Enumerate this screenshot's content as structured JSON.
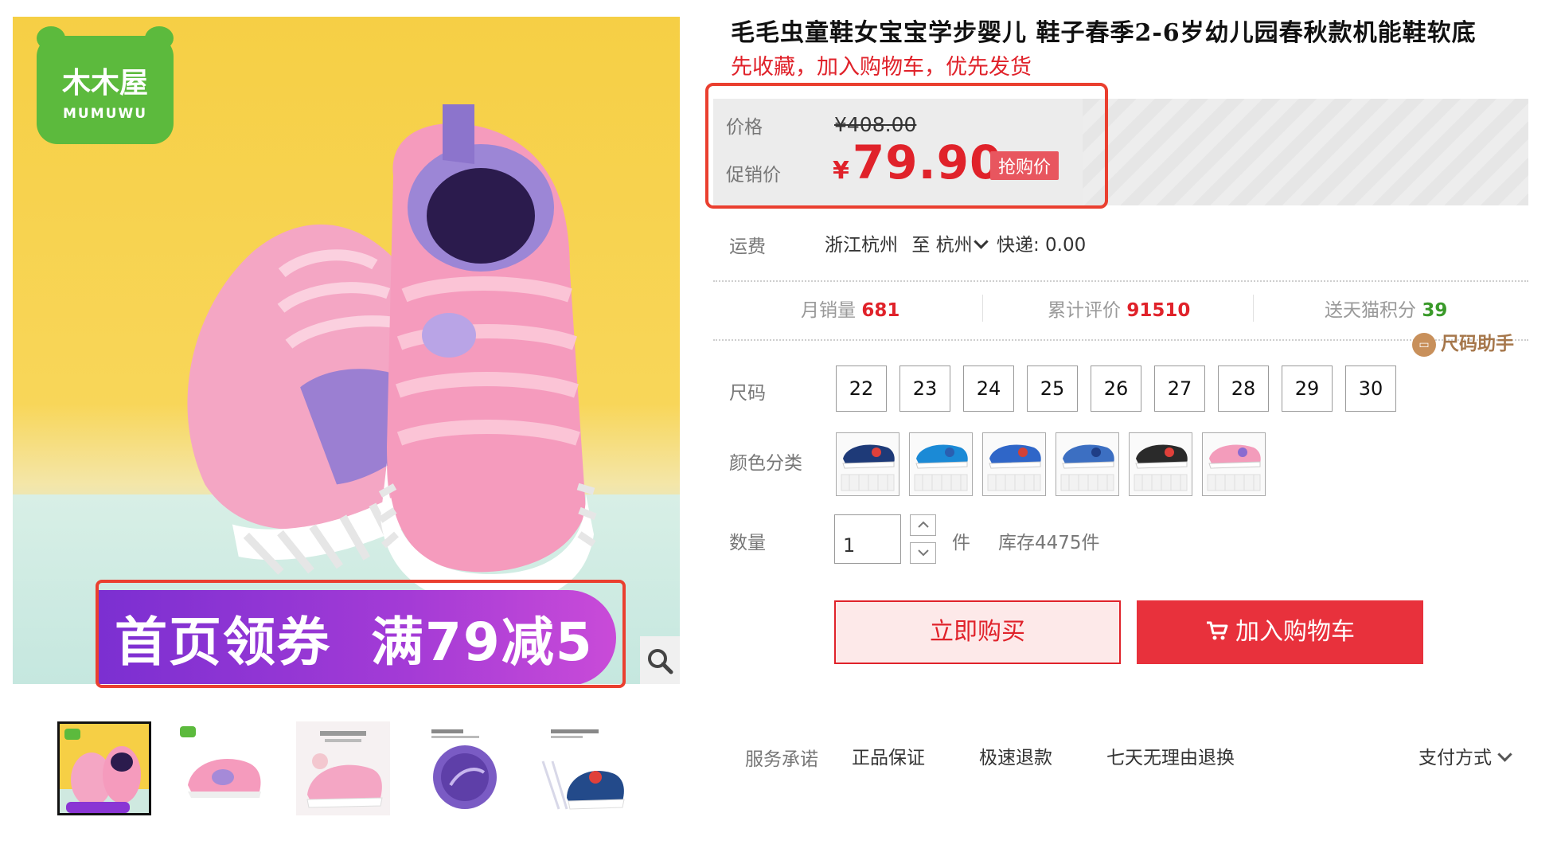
{
  "brand_logo": {
    "text_cn": "木木屋",
    "text_en": "MUMUWU"
  },
  "promo_banner": {
    "text": "首页领券  满79减5"
  },
  "product": {
    "title": "毛毛虫童鞋女宝宝学步婴儿 鞋子春季2-6岁幼儿园春秋款机能鞋软底",
    "subtitle": "先收藏，加入购物车，优先发货"
  },
  "price": {
    "label": "价格",
    "original_currency": "¥",
    "original_value": "408.00",
    "promo_label": "促销价",
    "promo_currency": "¥",
    "promo_value": "79.90",
    "badge": "抢购价"
  },
  "shipping": {
    "label": "运费",
    "from": "浙江杭州",
    "to_word": "至",
    "to": "杭州",
    "method": "快递: 0.00"
  },
  "stats": {
    "monthly_sales_label": "月销量",
    "monthly_sales_value": "681",
    "reviews_label": "累计评价",
    "reviews_value": "91510",
    "points_label": "送天猫积分",
    "points_value": "39"
  },
  "size_helper": {
    "icon_text": "▭",
    "label": "尺码助手"
  },
  "size": {
    "label": "尺码",
    "options": [
      "22",
      "23",
      "24",
      "25",
      "26",
      "27",
      "28",
      "29",
      "30"
    ]
  },
  "color": {
    "label": "颜色分类",
    "swatches": [
      {
        "upper": "#1e3a78",
        "accent": "#e0403a"
      },
      {
        "upper": "#1b8ad6",
        "accent": "#2a5fb0"
      },
      {
        "upper": "#2f66c8",
        "accent": "#d24136"
      },
      {
        "upper": "#3c6fc2",
        "accent": "#1f3e86"
      },
      {
        "upper": "#2a2a2a",
        "accent": "#e0403a"
      },
      {
        "upper": "#f39cbb",
        "accent": "#8a6bd0"
      }
    ]
  },
  "quantity": {
    "label": "数量",
    "value": "1",
    "unit": "件",
    "stock": "库存4475件"
  },
  "actions": {
    "buy_now": "立即购买",
    "add_to_cart": "加入购物车"
  },
  "services": {
    "label": "服务承诺",
    "items": [
      "正品保证",
      "极速退款",
      "七天无理由退换"
    ],
    "payment": "支付方式"
  },
  "colors": {
    "accent_red": "#e0222a",
    "promo_purple": "#7b2fd1",
    "brand_green": "#5cba3d"
  }
}
